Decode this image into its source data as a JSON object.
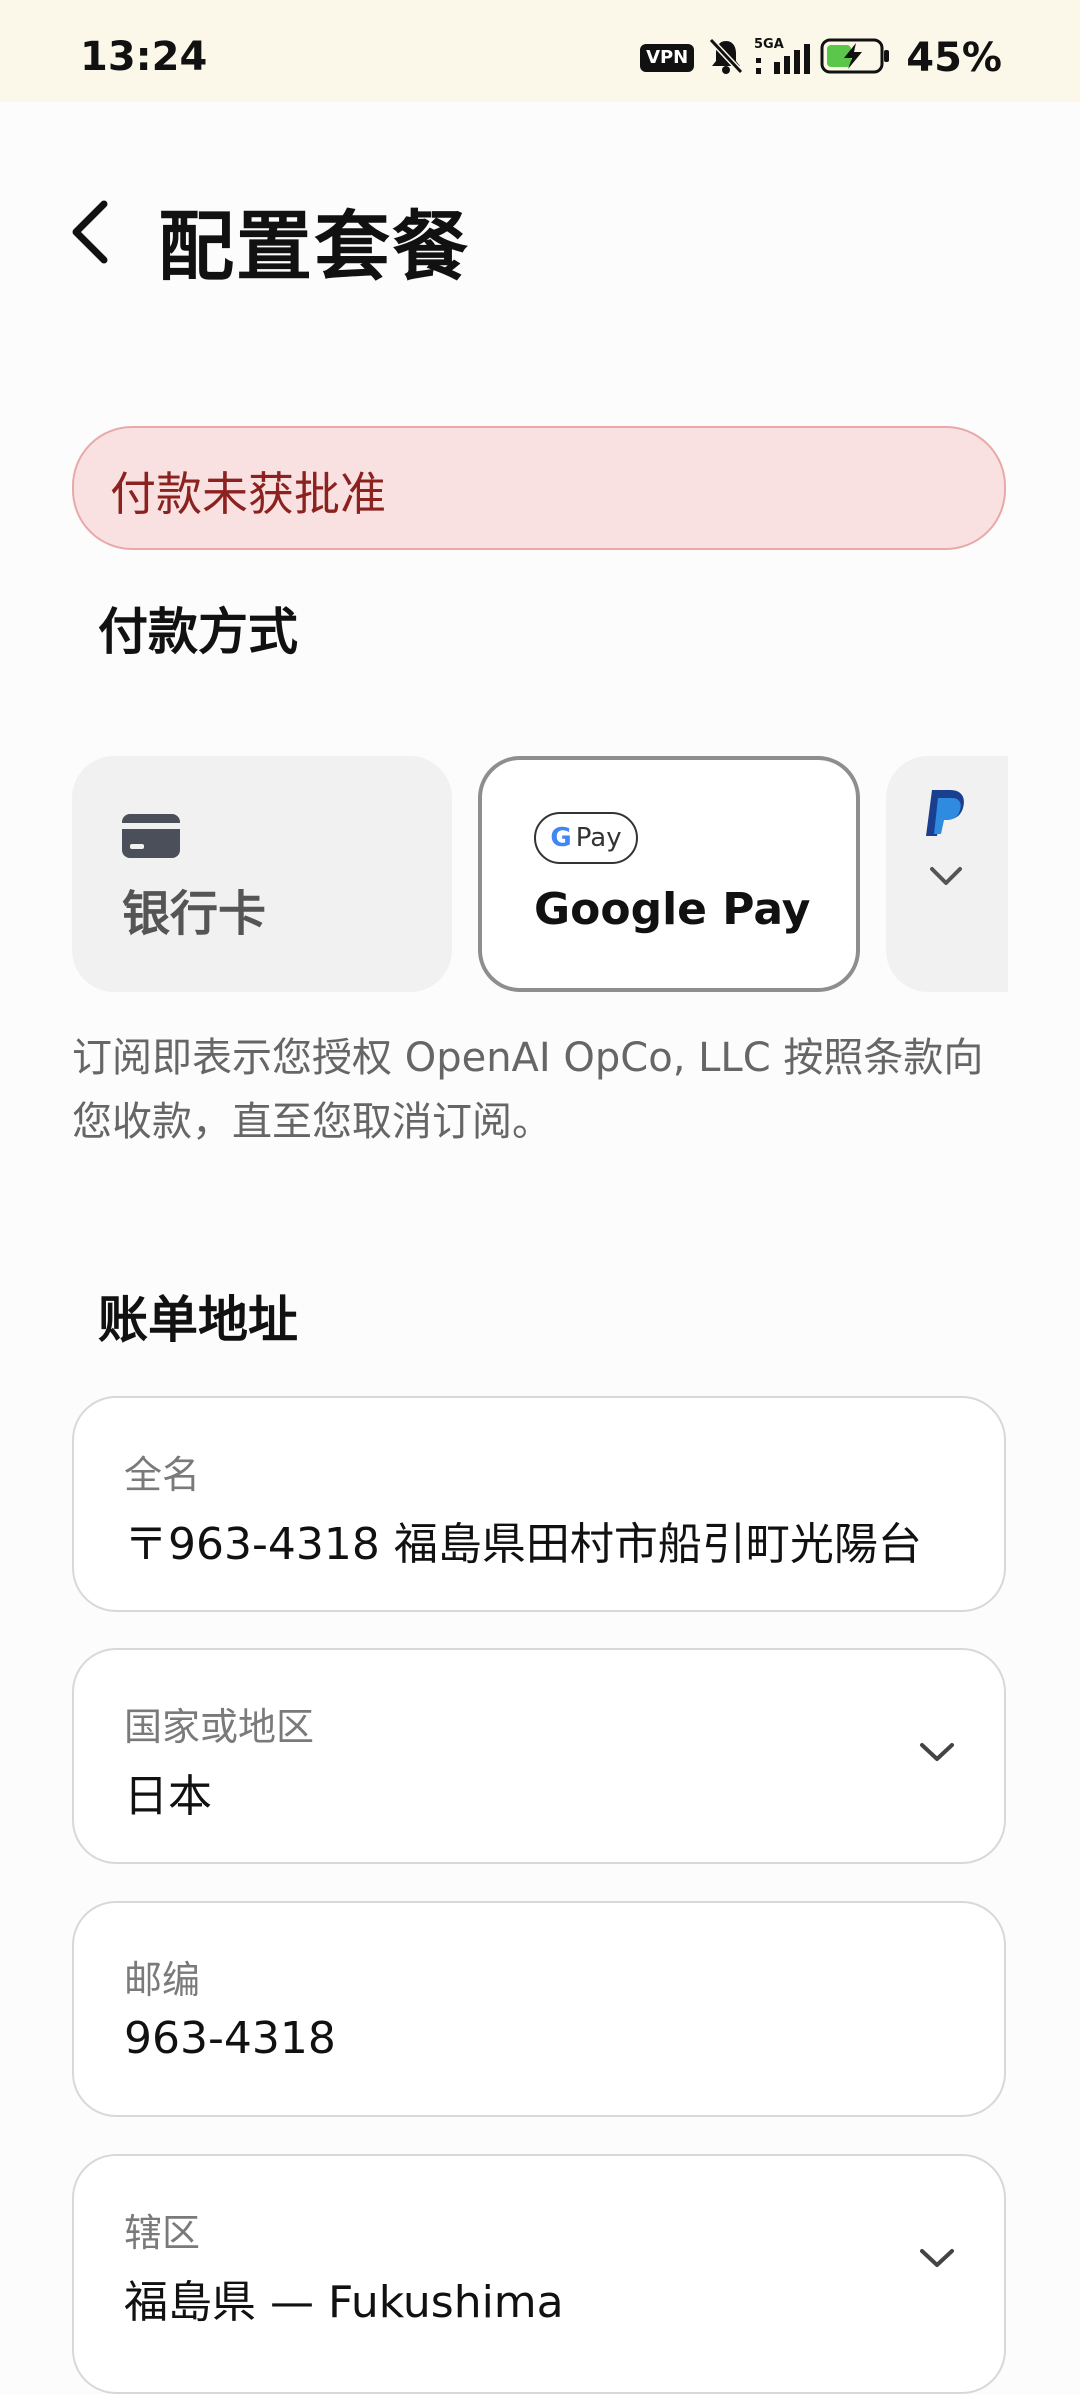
{
  "status_bar": {
    "time": "13:24",
    "vpn": "VPN",
    "network": "5GA",
    "battery": "45%"
  },
  "header": {
    "title": "配置套餐"
  },
  "error": {
    "message": "付款未获批准"
  },
  "payment": {
    "section_title": "付款方式",
    "methods": [
      {
        "label": "银行卡",
        "icon": "credit-card-icon"
      },
      {
        "label": "Google Pay",
        "badge": "Pay",
        "icon": "google-pay-icon",
        "selected": true
      },
      {
        "label": "",
        "icon": "paypal-icon"
      }
    ],
    "terms": "订阅即表示您授权 OpenAI OpCo, LLC 按照条款向您收款，直至您取消订阅。"
  },
  "billing": {
    "section_title": "账单地址",
    "fields": [
      {
        "label": "全名",
        "value": "〒963-4318 福島県田村市船引町光陽台"
      },
      {
        "label": "国家或地区",
        "value": "日本",
        "dropdown": true
      },
      {
        "label": "邮编",
        "value": "963-4318"
      },
      {
        "label": "辖区",
        "value": "福島県 — Fukushima",
        "dropdown": true
      }
    ]
  }
}
